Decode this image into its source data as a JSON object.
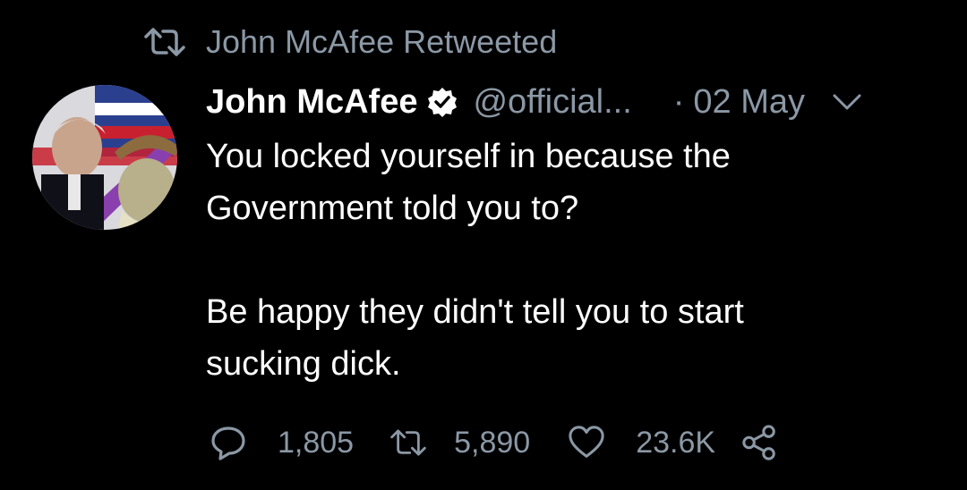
{
  "retweet_banner": {
    "icon": "retweet-icon",
    "text": "John McAfee Retweeted"
  },
  "tweet": {
    "avatar": "avatar-image",
    "display_name": "John McAfee",
    "verified_icon": "verified-badge-icon",
    "handle": "@official...",
    "separator": "·",
    "date": "02 May",
    "menu_icon": "chevron-down-icon",
    "body": {
      "line1": "You locked yourself in because the",
      "line2": "Government told you to?",
      "line3": "Be happy they didn't tell you to start",
      "line4": "sucking dick."
    },
    "actions": {
      "reply": {
        "icon": "reply-icon",
        "count": "1,805"
      },
      "retweet": {
        "icon": "retweet-icon",
        "count": "5,890"
      },
      "like": {
        "icon": "heart-icon",
        "count": "23.6K"
      },
      "share": {
        "icon": "share-icon"
      }
    }
  },
  "colors": {
    "background": "#000000",
    "primary_text": "#ffffff",
    "secondary_text": "#8b98a5"
  }
}
